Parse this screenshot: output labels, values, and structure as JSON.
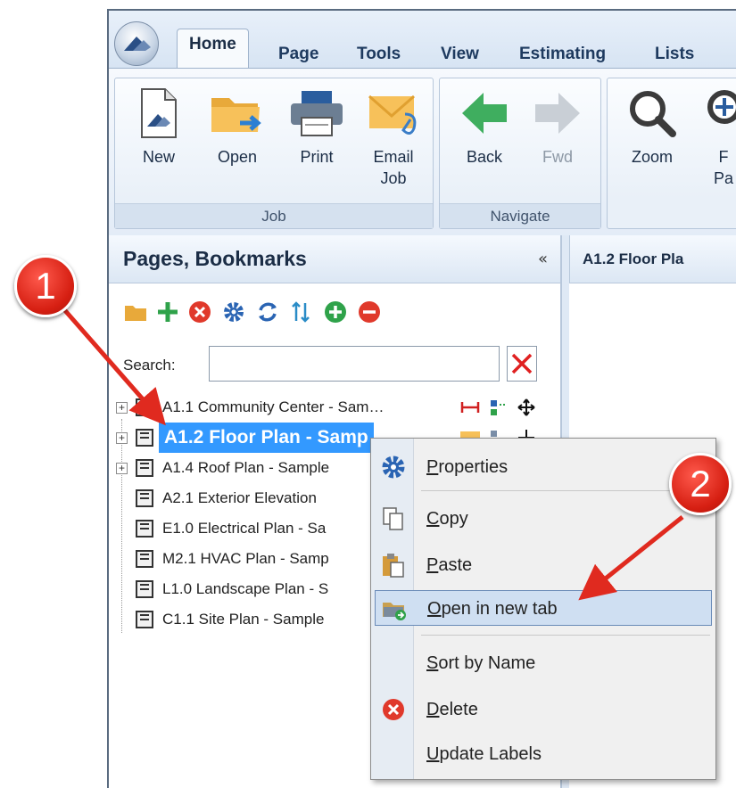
{
  "ribbon": {
    "tabs": [
      "Home",
      "Page",
      "Tools",
      "View",
      "Estimating",
      "Lists"
    ],
    "groups": {
      "job": {
        "label": "Job",
        "buttons": {
          "new": "New",
          "open": "Open",
          "print": "Print",
          "email_line1": "Email",
          "email_line2": "Job"
        }
      },
      "navigate": {
        "label": "Navigate",
        "buttons": {
          "back": "Back",
          "fwd": "Fwd"
        }
      },
      "zoom": {
        "buttons": {
          "zoom": "Zoom",
          "fit_line1": "F",
          "fit_line2": "Pa"
        }
      }
    }
  },
  "panel": {
    "title": "Pages, Bookmarks",
    "collapse": "«",
    "search_label": "Search:",
    "search_value": ""
  },
  "doc_tab": {
    "label": "A1.2 Floor Pla"
  },
  "tree": [
    {
      "label": "A1.1 Community Center - Sam…"
    },
    {
      "label": "A1.2 Floor Plan - Samp"
    },
    {
      "label": "A1.4 Roof Plan - Sample"
    },
    {
      "label": "A2.1 Exterior Elevation"
    },
    {
      "label": "E1.0 Electrical Plan - Sa"
    },
    {
      "label": "M2.1 HVAC Plan - Samp"
    },
    {
      "label": "L1.0 Landscape Plan - S"
    },
    {
      "label": "C1.1 Site Plan - Sample"
    }
  ],
  "context_menu": {
    "properties": {
      "ul": "P",
      "rest": "roperties"
    },
    "copy": {
      "ul": "C",
      "rest": "opy"
    },
    "paste": {
      "ul": "P",
      "rest": "aste"
    },
    "open_new_tab": {
      "ul": "O",
      "rest": "pen in new tab"
    },
    "sort_by_name": {
      "ul": "S",
      "rest": "ort by Name"
    },
    "delete": {
      "ul": "D",
      "rest": "elete"
    },
    "update_labels": {
      "ul": "U",
      "rest": "pdate Labels"
    }
  },
  "callouts": {
    "one": "1",
    "two": "2"
  },
  "colors": {
    "selection": "#3399ff",
    "callout": "#d61f12",
    "menu_hover": "#cfdff2"
  }
}
